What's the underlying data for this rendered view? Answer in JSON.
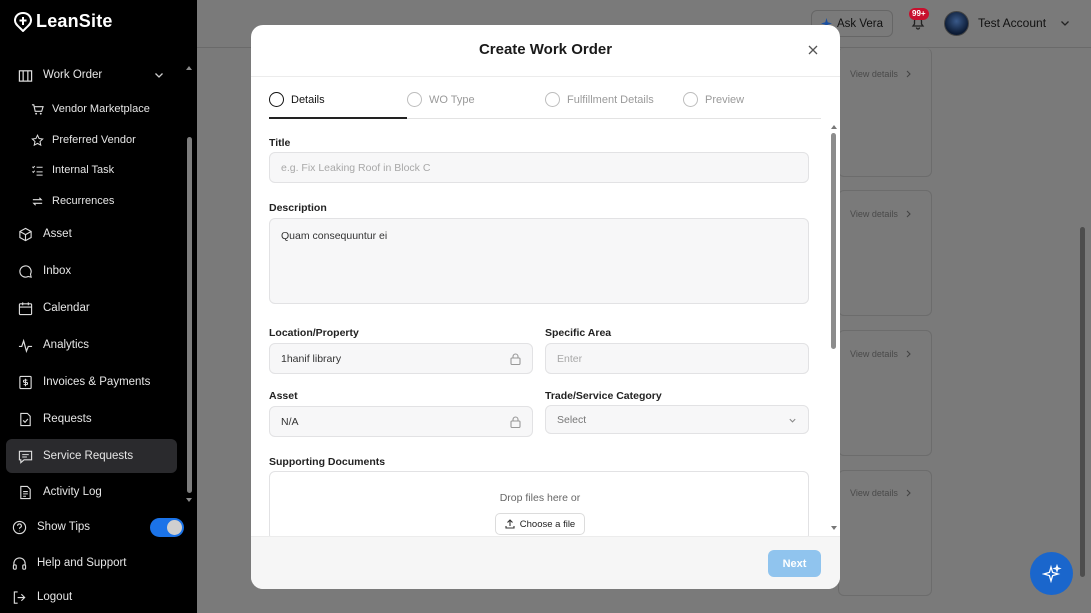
{
  "app": {
    "name": "LeanSite"
  },
  "sidebar": {
    "work_order": "Work Order",
    "sub_items": [
      "Vendor Marketplace",
      "Preferred Vendor",
      "Internal Task",
      "Recurrences"
    ],
    "items": [
      "Asset",
      "Inbox",
      "Calendar",
      "Analytics",
      "Invoices & Payments",
      "Requests",
      "Service Requests",
      "Activity Log"
    ],
    "active_item": "Service Requests",
    "show_tips": "Show Tips",
    "show_tips_enabled": true,
    "help": "Help and Support",
    "logout": "Logout"
  },
  "header": {
    "ask_vera": "Ask Vera",
    "notifications_badge": "99+",
    "account_name": "Test Account"
  },
  "background": {
    "view_details": [
      "View details",
      "View details",
      "View details",
      "View details"
    ]
  },
  "modal": {
    "title": "Create Work Order",
    "steps": [
      "Details",
      "WO Type",
      "Fulfillment Details",
      "Preview"
    ],
    "active_step": "Details",
    "title_label": "Title",
    "title_placeholder": "e.g. Fix Leaking Roof in Block C",
    "description_label": "Description",
    "description_value": "Quam consequuntur ei",
    "location_label": "Location/Property",
    "location_value": "1hanif library",
    "specific_area_label": "Specific Area",
    "specific_area_placeholder": "Enter",
    "asset_label": "Asset",
    "asset_value": "N/A",
    "trade_label": "Trade/Service Category",
    "trade_placeholder": "Select",
    "documents_label": "Supporting Documents",
    "drop_text": "Drop files here or",
    "choose_file": "Choose a file",
    "next": "Next"
  },
  "colors": {
    "accent": "#1b73e8",
    "next_disabled": "#90c4ee",
    "badge": "#c8102e",
    "sidebar_bg": "#000000"
  }
}
